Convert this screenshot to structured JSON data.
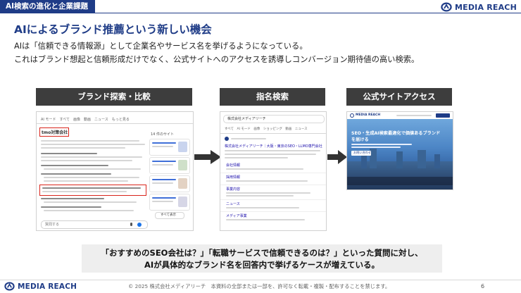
{
  "header": {
    "section_title": "AI検索の進化と企業課題",
    "brand": "MEDIA REACH"
  },
  "slide": {
    "heading": "AIによるブランド推薦という新しい機会",
    "lead_1": "AIは「信頼できる情報源」として企業名やサービス名を挙げるようになっている。",
    "lead_2": "これはブランド想起と信頼形成だけでなく、公式サイトへのアクセスを誘導しコンバージョン期待値の高い検索。"
  },
  "panels": [
    {
      "label": "ブランド探索・比較"
    },
    {
      "label": "指名検索"
    },
    {
      "label": "公式サイトアクセス"
    }
  ],
  "shot1": {
    "tabs": [
      "AI モード",
      "すべて",
      "画像",
      "動画",
      "ニュース",
      "もっと見る"
    ],
    "highlight_1": "tmo対策会社",
    "search_placeholder": "質問する",
    "more_label": "すべて表示",
    "side_label": "14 件のサイト"
  },
  "shot2": {
    "search_value": "株式会社メディアリーチ",
    "tabs": [
      "すべて",
      "AI モード",
      "画像",
      "ショッピング",
      "動画",
      "ニュース"
    ],
    "result_title": "株式会社メディアリーチ｜大阪・東京のSEO・LLMO専門会社",
    "sitelinks": [
      "会社情報",
      "採用情報",
      "事業内容",
      "ニュース",
      "メディア事業"
    ]
  },
  "shot3": {
    "brand": "MEDIA REACH",
    "hero_1": "SEO・生成AI検索最適化で価値あるブランド",
    "hero_2": "を届ける",
    "cta": "お問い合わせ"
  },
  "note": {
    "line_1": "「おすすめのSEO会社は？」「転職サービスで信頼できるのは？」といった質問に対し、",
    "line_2": "AIが具体的なブランド名を回答内で挙げるケースが増えている。"
  },
  "footer": {
    "brand": "MEDIA REACH",
    "copyright": "© 2025 株式会社メディアリーチ　本資料の全部または一部を、許可なく転載・複製・配布することを禁じます。",
    "page": "6"
  },
  "colors": {
    "navy": "#1f3c87",
    "panel_head": "#3d3d3d",
    "highlight": "#d9241b",
    "note_bg": "#eeeeee"
  }
}
